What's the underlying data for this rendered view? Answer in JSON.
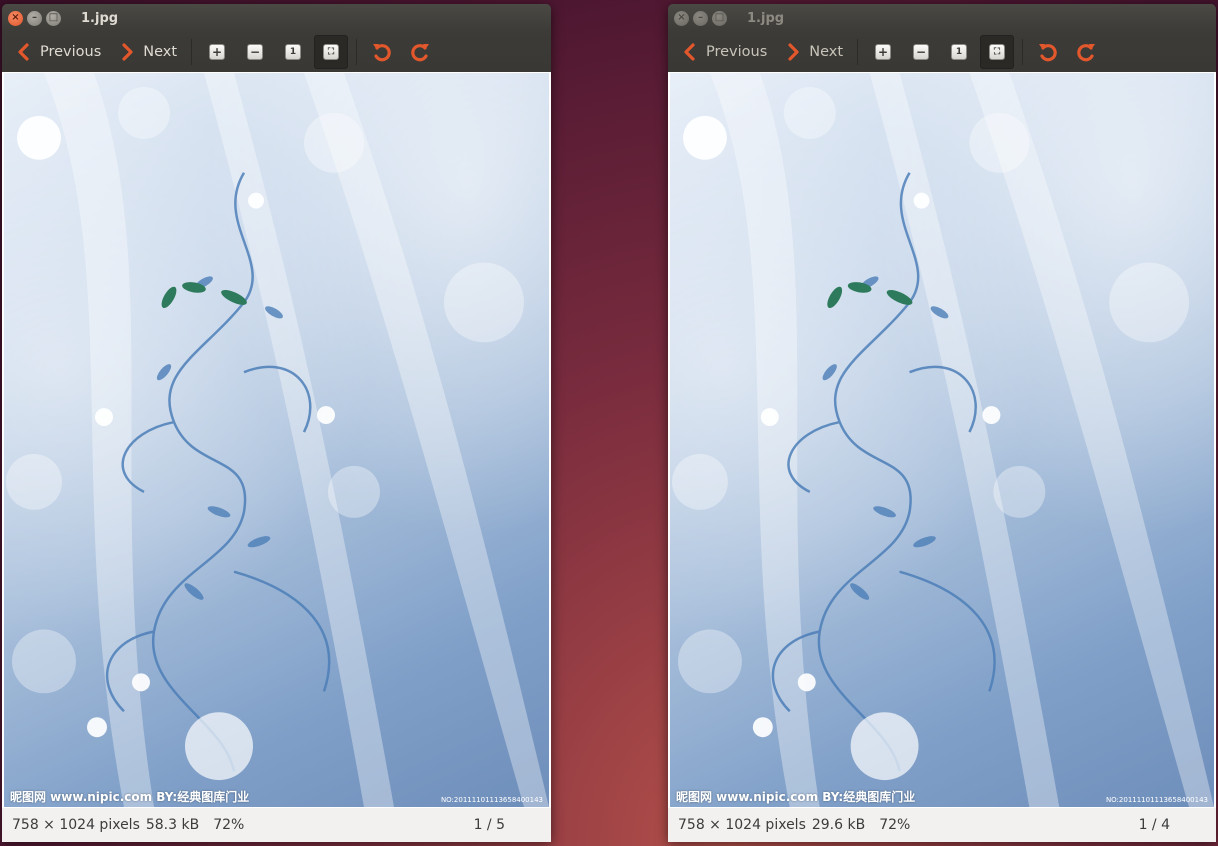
{
  "windows": [
    {
      "title": "1.jpg",
      "toolbar": {
        "previous": "Previous",
        "next": "Next"
      },
      "image": {
        "watermark": "昵图网 www.nipic.com  BY:经典图库门业",
        "code": "NO:20111101113658400143"
      },
      "status": {
        "dimensions": "758 × 1024 pixels",
        "size": "58.3 kB",
        "zoom": "72%",
        "page": "1 / 5"
      }
    },
    {
      "title": "1.jpg",
      "toolbar": {
        "previous": "Previous",
        "next": "Next"
      },
      "image": {
        "watermark": "昵图网 www.nipic.com  BY:经典图库门业",
        "code": "NO:20111101113658400143"
      },
      "status": {
        "dimensions": "758 × 1024 pixels",
        "size": "29.6 kB",
        "zoom": "72%",
        "page": "1 / 4"
      }
    }
  ],
  "colors": {
    "accent": "#e2572b",
    "toolbar": "#3c3b37",
    "status_bg": "#f2f1f0"
  }
}
